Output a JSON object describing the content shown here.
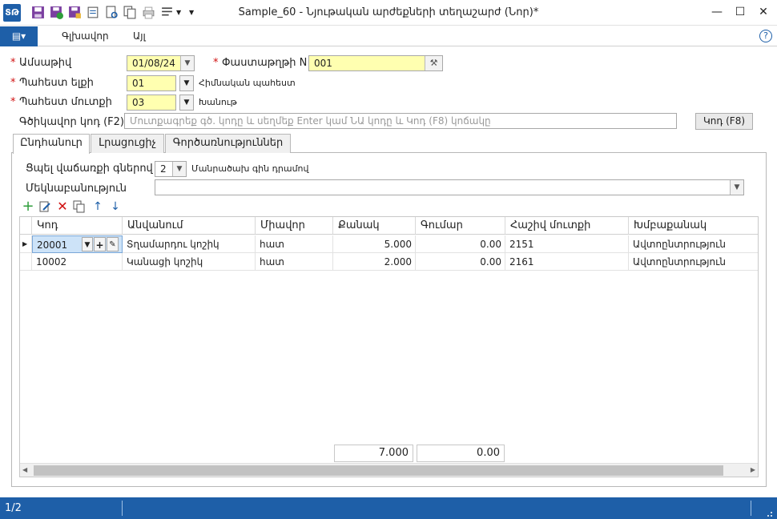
{
  "window": {
    "title": "Sample_60 - Նյութական արժեքների տեղաշարժ (Նոր)*",
    "app_icon": "ՏԹ",
    "controls": {
      "minimize": "—",
      "maximize": "☐",
      "close": "✕"
    }
  },
  "ribbon": {
    "tabs": [
      "Գլխավոր",
      "Այլ"
    ],
    "help": "?"
  },
  "form": {
    "date_label": "Ամսաթիվ",
    "date_value": "01/08/24",
    "doc_no_label": "Փաստաթղթի N",
    "doc_no_value": "001",
    "warehouse_out_label": "Պահեստ ելքի",
    "warehouse_out_value": "01",
    "warehouse_out_name": "Հիմնական պահեստ",
    "warehouse_in_label": "Պահեստ մուտքի",
    "warehouse_in_value": "03",
    "warehouse_in_name": "Խանութ",
    "barcode_label": "Գծիկավոր կոդ (F2)",
    "barcode_placeholder": "Մուտքագրեք գծ. կոդը և սեղմեք Enter կամ ՆԱ կոդը և Կոդ (F8) կոճակը",
    "code_button": "Կոդ (F8)"
  },
  "tabs": [
    "Ընդհանուր",
    "Լրացուցիչ",
    "Գործառնություններ"
  ],
  "general": {
    "price_columns_label": "Ցպել վաճառքի գներով",
    "price_columns_value": "2",
    "retail_label": "Մանրածախ գին դրամով",
    "comment_label": "Մեկնաբանություն",
    "comment_value": ""
  },
  "table": {
    "headers": [
      "Կոդ",
      "Անվանում",
      "Միավոր",
      "Քանակ",
      "Գումար",
      "Հաշիվ մուտքի",
      "Խմբաքանակ"
    ],
    "rows": [
      [
        "20001",
        "Տղամարդու կոշիկ",
        "հատ",
        "5.000",
        "0.00",
        "2151",
        "Ավտոընտրություն"
      ],
      [
        "10002",
        "Կանացի կոշիկ",
        "հատ",
        "2.000",
        "0.00",
        "2161",
        "Ավտոընտրություն"
      ]
    ],
    "totals": {
      "quantity": "7.000",
      "amount": "0.00"
    }
  },
  "status": {
    "page": "1/2"
  },
  "colors": {
    "accent": "#1e5fa8",
    "required": "#d01010",
    "highlight": "#ffffb0"
  }
}
